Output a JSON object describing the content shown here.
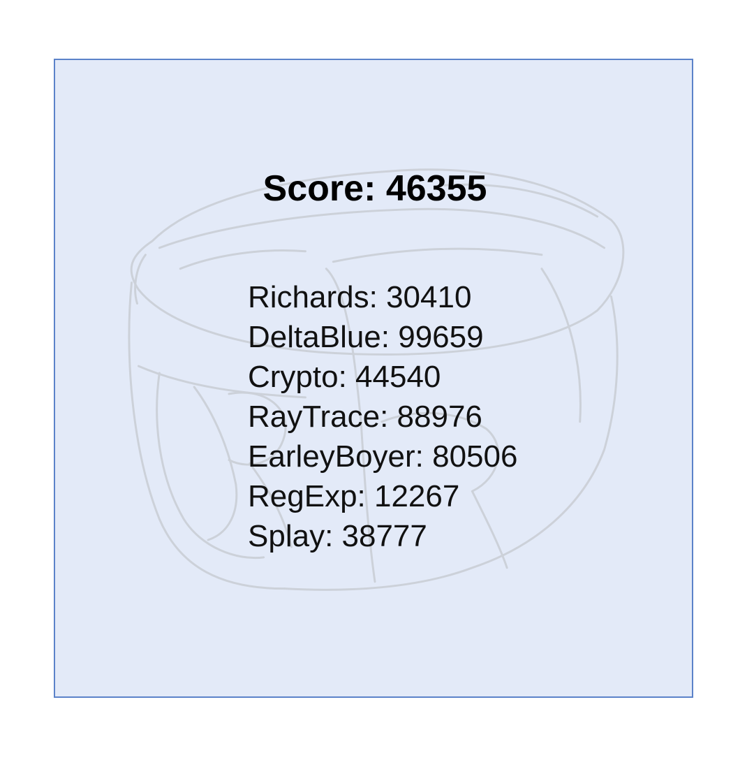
{
  "score": {
    "label": "Score: 46355"
  },
  "results": [
    {
      "text": "Richards: 30410"
    },
    {
      "text": "DeltaBlue: 99659"
    },
    {
      "text": "Crypto: 44540"
    },
    {
      "text": "RayTrace: 88976"
    },
    {
      "text": "EarleyBoyer: 80506"
    },
    {
      "text": "RegExp: 12267"
    },
    {
      "text": "Splay: 38777"
    }
  ],
  "colors": {
    "panel_background": "#e3eaf8",
    "panel_border": "#5b82c9",
    "sketch_stroke": "#c9cdd4"
  },
  "background_art": {
    "icon": "pencil-sketch-box-illustration"
  }
}
